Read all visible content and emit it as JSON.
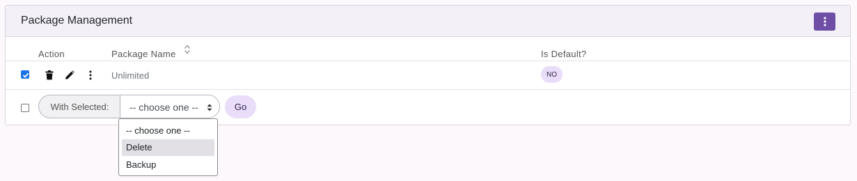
{
  "card": {
    "title": "Package Management"
  },
  "table": {
    "columns": [
      "Action",
      "Package Name",
      "Is Default?"
    ],
    "rows": [
      {
        "checked": true,
        "package_name": "Unlimited",
        "is_default": "NO"
      }
    ]
  },
  "bulk": {
    "with_selected_label": "With Selected:",
    "select_value": "-- choose one --",
    "go_label": "Go",
    "options": [
      "-- choose one --",
      "Delete",
      "Backup"
    ],
    "highlighted_option": "Delete"
  },
  "colors": {
    "accent": "#6f4fa6",
    "badge_bg": "#e9ddfa",
    "checkbox": "#1a73e8"
  },
  "icons": {
    "header_menu": "kebab-vertical-icon",
    "delete": "trash-icon",
    "edit": "pencil-icon",
    "more": "kebab-vertical-icon",
    "sort": "sort-updown-icon",
    "select_caret": "caret-updown-icon"
  }
}
